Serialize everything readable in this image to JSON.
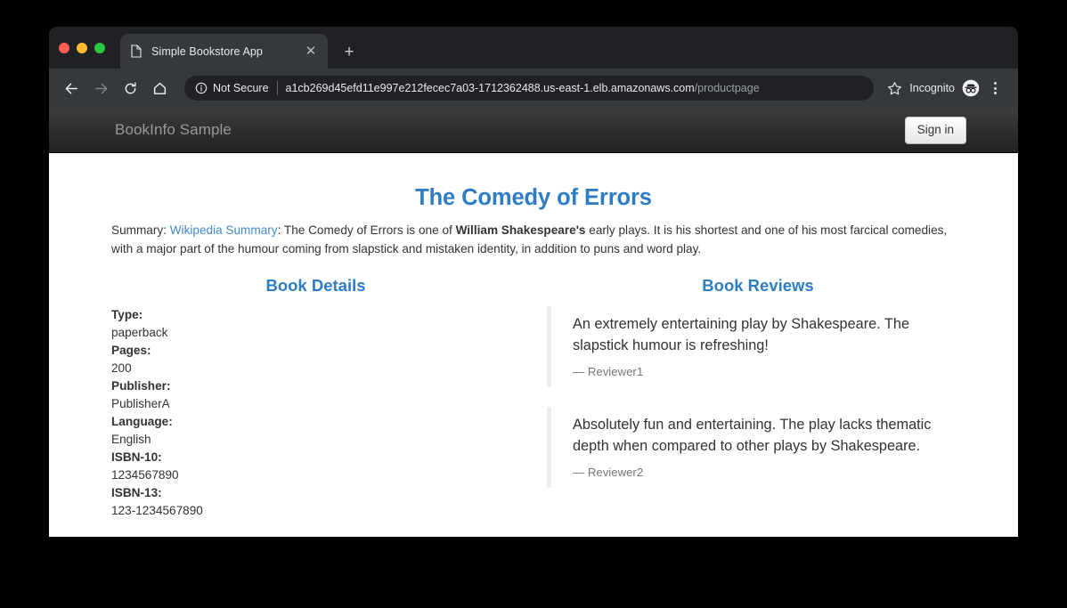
{
  "browser": {
    "tab": {
      "title": "Simple Bookstore App",
      "favicon_icon": "document-icon",
      "close_icon": "close-icon"
    },
    "new_tab_icon": "plus-icon",
    "traffic_lights": [
      {
        "name": "close",
        "color": "#ff5f57"
      },
      {
        "name": "minimize",
        "color": "#febc2e"
      },
      {
        "name": "maximize",
        "color": "#28c840"
      }
    ],
    "toolbar": {
      "back_icon": "back-arrow-icon",
      "forward_icon": "forward-arrow-icon",
      "reload_icon": "reload-icon",
      "home_icon": "home-icon",
      "security_icon": "info-circle-icon",
      "security_text": "Not Secure",
      "url_host": "a1cb269d45efd11e997e212fecec7a03-1712362488.us-east-1.elb.amazonaws.com",
      "url_path": "/productpage",
      "star_icon": "star-icon",
      "incognito_label": "Incognito",
      "incognito_icon": "incognito-icon",
      "menu_icon": "three-dots-menu-icon"
    }
  },
  "site": {
    "brand": "BookInfo Sample",
    "signin_label": "Sign in",
    "title": "The Comedy of Errors",
    "summary": {
      "prefix": "Summary: ",
      "link_text": "Wikipedia Summary",
      "body_1": ": The Comedy of Errors is one of ",
      "bold_1": "William Shakespeare's",
      "body_2": " early plays. It is his shortest and one of his most farcical comedies, with a major part of the humour coming from slapstick and mistaken identity, in addition to puns and word play."
    },
    "details": {
      "heading": "Book Details",
      "items": [
        {
          "label": "Type:",
          "value": "paperback"
        },
        {
          "label": "Pages:",
          "value": "200"
        },
        {
          "label": "Publisher:",
          "value": "PublisherA"
        },
        {
          "label": "Language:",
          "value": "English"
        },
        {
          "label": "ISBN-10:",
          "value": "1234567890"
        },
        {
          "label": "ISBN-13:",
          "value": "123-1234567890"
        }
      ]
    },
    "reviews": {
      "heading": "Book Reviews",
      "items": [
        {
          "text": "An extremely entertaining play by Shakespeare. The slapstick humour is refreshing!",
          "author": "— Reviewer1"
        },
        {
          "text": "Absolutely fun and entertaining. The play lacks thematic depth when compared to other plays by Shakespeare.",
          "author": "— Reviewer2"
        }
      ]
    }
  },
  "colors": {
    "accent_blue": "#2e7dc4",
    "link_blue": "#428bca",
    "navbar_dark": "#2e3033",
    "chrome_dark": "#35393d",
    "tabstrip_dark": "#202124"
  }
}
